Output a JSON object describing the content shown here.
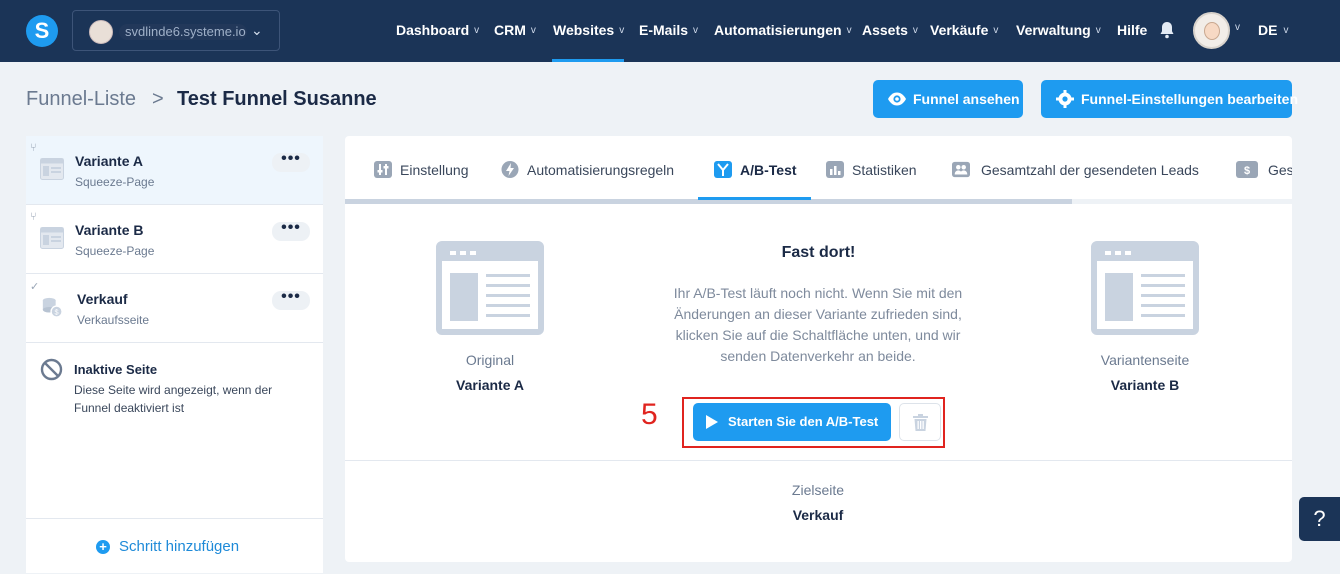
{
  "nav": {
    "account_name": "svdlinde6.systeme.io",
    "items": [
      {
        "label": "Dashboard"
      },
      {
        "label": "CRM"
      },
      {
        "label": "Websites"
      },
      {
        "label": "E-Mails"
      },
      {
        "label": "Automatisierungen"
      },
      {
        "label": "Assets"
      },
      {
        "label": "Verkäufe"
      },
      {
        "label": "Verwaltung"
      },
      {
        "label": "Hilfe"
      }
    ],
    "active": "Websites",
    "language": "DE",
    "logo_letter": "S"
  },
  "header": {
    "breadcrumb_parent": "Funnel-Liste",
    "breadcrumb_separator": ">",
    "title": "Test Funnel Susanne",
    "view_button": "Funnel ansehen",
    "settings_button": "Funnel-Einstellungen bearbeiten"
  },
  "sidebar": {
    "steps": [
      {
        "title": "Variante A",
        "subtitle": "Squeeze-Page",
        "menu": "•••"
      },
      {
        "title": "Variante B",
        "subtitle": "Squeeze-Page",
        "menu": "•••"
      },
      {
        "title": "Verkauf",
        "subtitle": "Verkaufsseite",
        "menu": "•••"
      }
    ],
    "inactive_title": "Inaktive Seite",
    "inactive_desc": "Diese Seite wird angezeigt, wenn der Funnel deaktiviert ist",
    "add_step": "Schritt hinzufügen"
  },
  "tabs": [
    {
      "label": "Einstellung"
    },
    {
      "label": "Automatisierungsregeln"
    },
    {
      "label": "A/B-Test"
    },
    {
      "label": "Statistiken"
    },
    {
      "label": "Gesamtzahl der gesendeten Leads"
    },
    {
      "label": "Ges"
    }
  ],
  "active_tab": "A/B-Test",
  "abtest": {
    "heading": "Fast dort!",
    "message": "Ihr A/B-Test läuft noch nicht. Wenn Sie mit den Änderungen an dieser Variante zufrieden sind, klicken Sie auf die Schaltfläche unten, und wir senden Datenverkehr an beide.",
    "original_label": "Original",
    "original_value": "Variante A",
    "variant_label": "Variantenseite",
    "variant_value": "Variante B",
    "start_button": "Starten Sie den A/B-Test",
    "annotation_number": "5",
    "target_label": "Zielseite",
    "target_value": "Verkauf"
  },
  "help_button": "?",
  "colors": {
    "nav_bg": "#1b3457",
    "accent": "#1e9bf0",
    "annotation": "#e0241f",
    "page_bg": "#eef2f6"
  }
}
